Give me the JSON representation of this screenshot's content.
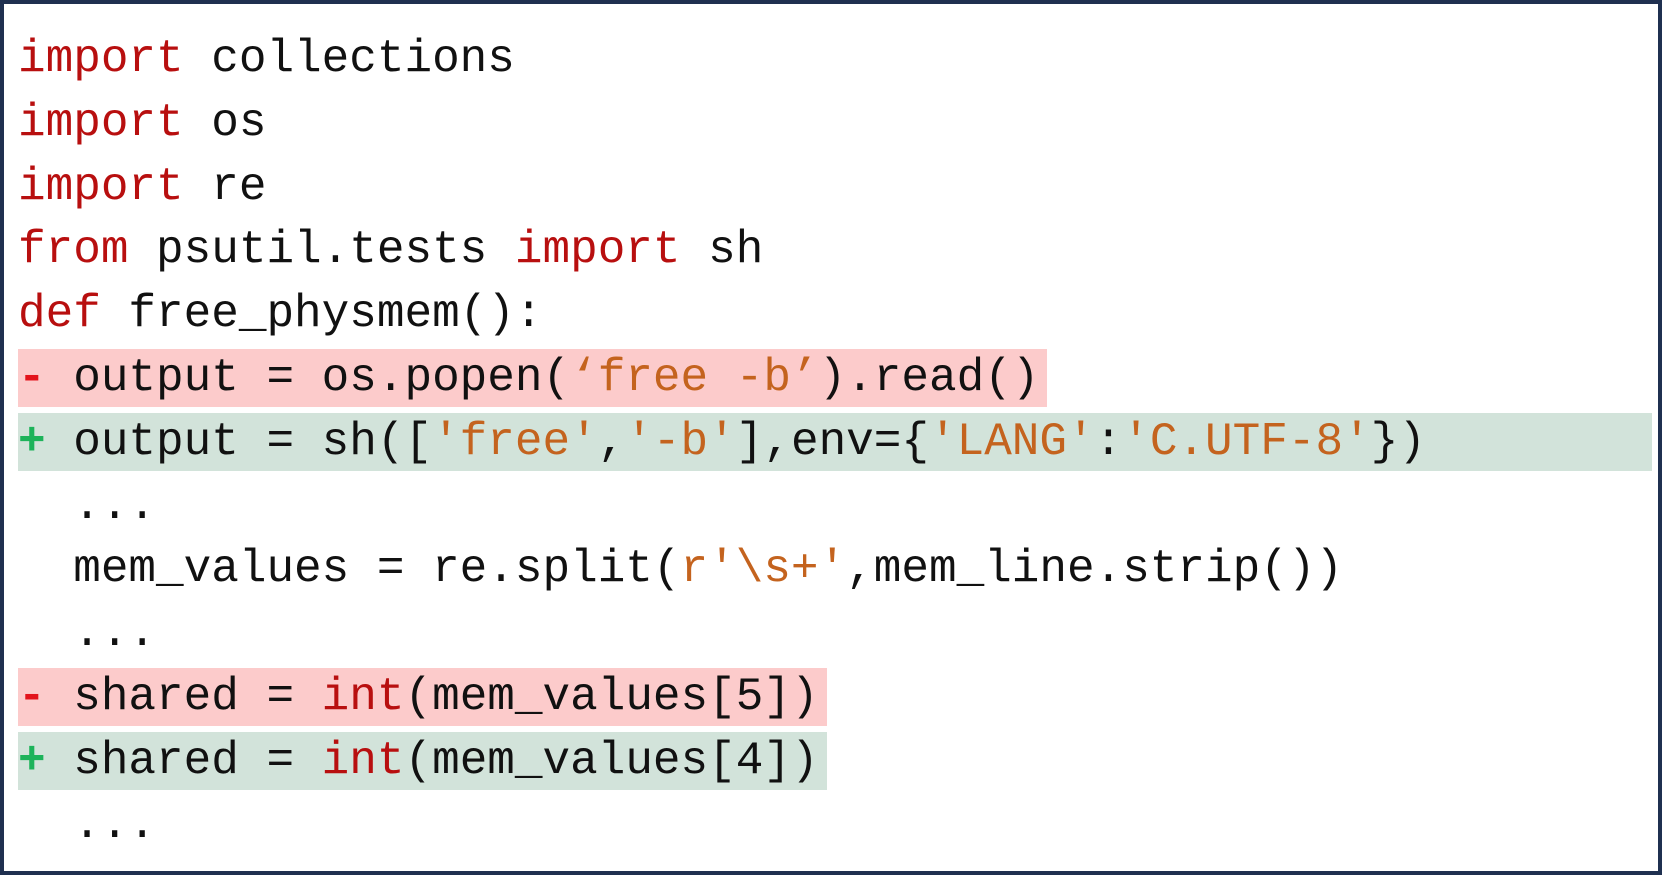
{
  "code": {
    "l1_kw": "import",
    "l1_rest": " collections",
    "l2_kw": "import",
    "l2_rest": " os",
    "l3_kw": "import",
    "l3_rest": " re",
    "l4_kw1": "from",
    "l4_mid": " psutil.tests ",
    "l4_kw2": "import",
    "l4_rest": " sh",
    "l5_kw": "def",
    "l5_rest": " free_physmem():",
    "l6_mark": "-",
    "l6_a": " output = os.popen(",
    "l6_str": "‘free -b’",
    "l6_b": ").read()",
    "l7_mark": "+",
    "l7_a": " output = sh([",
    "l7_s1": "'free'",
    "l7_c1": ",",
    "l7_s2": "'-b'",
    "l7_b": "],env={",
    "l7_s3": "'LANG'",
    "l7_c2": ":",
    "l7_s4": "'C.UTF-8'",
    "l7_c": "})",
    "l8": "  ...",
    "l9_a": "  mem_values = re.split(",
    "l9_str": "r'\\s+'",
    "l9_b": ",mem_line.strip())",
    "l10": "  ...",
    "l11_mark": "-",
    "l11_a": " shared = ",
    "l11_kw": "int",
    "l11_b": "(mem_values[5])",
    "l12_mark": "+",
    "l12_a": " shared = ",
    "l12_kw": "int",
    "l12_b": "(mem_values[4])",
    "l13": "  ..."
  },
  "colors": {
    "keyword": "#b80f0f",
    "string": "#c4631e",
    "deleted_bg": "#fccbcb",
    "added_bg": "#d2e3da",
    "deleted_marker": "#e3141c",
    "added_marker": "#1db35a",
    "border": "#1f3050"
  }
}
